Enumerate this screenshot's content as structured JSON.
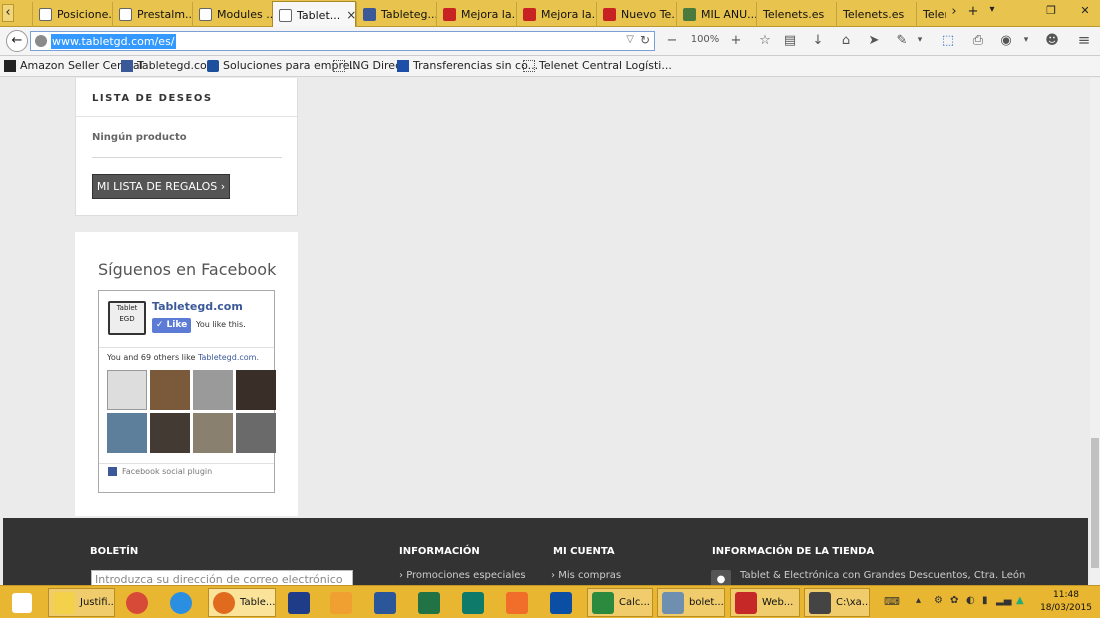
{
  "browser": {
    "tabs": [
      {
        "label": "Posicione...",
        "icon": "page-icon"
      },
      {
        "label": "Prestalm...",
        "icon": "page-icon"
      },
      {
        "label": "Modules ...",
        "icon": "page-icon"
      },
      {
        "label": "Tablet...",
        "icon": "page-icon",
        "active": true,
        "close": "×"
      },
      {
        "label": "Tableteg...",
        "icon": "facebook-icon"
      },
      {
        "label": "Mejora la...",
        "icon": "w-icon"
      },
      {
        "label": "Mejora la...",
        "icon": "w-icon"
      },
      {
        "label": "Nuevo Te...",
        "icon": "w-icon"
      },
      {
        "label": "MIL ANU...",
        "icon": "m-icon"
      },
      {
        "label": "Telenets.es",
        "icon": "none"
      },
      {
        "label": "Telenets.es",
        "icon": "none"
      },
      {
        "label": "Telen",
        "icon": "none"
      }
    ],
    "tab_controls": {
      "scroll_left": "‹",
      "scroll_right": "›",
      "new_tab": "+",
      "list": "▾",
      "restore": "❐",
      "close": "✕"
    },
    "url": "www.tabletgd.com/es/",
    "zoom": "100%",
    "nav": {
      "back": "←",
      "zoom_out": "−",
      "zoom_in": "+",
      "star": "☆",
      "clipboard": "▤",
      "download": "↓",
      "home": "⌂",
      "send": "➤",
      "pin": "✎",
      "menu": "≡"
    },
    "bookmarks": [
      {
        "label": "Amazon Seller Central",
        "icon": "amazon-icon"
      },
      {
        "label": "Tabletegd.com",
        "icon": "facebook-icon"
      },
      {
        "label": "Soluciones para empre...",
        "icon": "paypal-icon"
      },
      {
        "label": "ING Direct",
        "icon": "page-icon"
      },
      {
        "label": "Transferencias sin co...",
        "icon": "bank-icon"
      },
      {
        "label": "Telenet Central Logísti...",
        "icon": "page-icon"
      }
    ]
  },
  "page": {
    "wishlist": {
      "heading": "LISTA DE DESEOS",
      "empty": "Ningún producto",
      "button": "MI LISTA DE REGALOS ›"
    },
    "facebook": {
      "title": "Síguenos en Facebook",
      "page_name": "Tabletegd.com",
      "logo_text": "Tablet EGD",
      "like_button": "Like",
      "you_like": "You like this.",
      "others_prefix": "You and 69 others like ",
      "others_link": "Tabletegd.com.",
      "plugin": "Facebook social plugin",
      "faces": [
        "logo",
        "photo",
        "photo",
        "photo",
        "photo",
        "photo",
        "photo",
        "photo"
      ]
    },
    "footer": {
      "newsletter_heading": "BOLETÍN",
      "newsletter_placeholder": "Introduzca su dirección de correo electrónico",
      "info_heading": "INFORMACIÓN",
      "info_link": "Promociones especiales",
      "account_heading": "MI CUENTA",
      "account_link": "Mis compras",
      "store_heading": "INFORMACIÓN DE LA TIENDA",
      "store_text": "Tablet & Electrónica con Grandes Descuentos, Ctra. León"
    }
  },
  "taskbar": {
    "items": [
      {
        "label": "Justifi...",
        "icon": "folder-icon",
        "color": "#f4d14b"
      },
      {
        "label": "",
        "icon": "chrome-icon",
        "color": "#d84a38"
      },
      {
        "label": "",
        "icon": "ie-icon",
        "color": "#2a8fe0"
      },
      {
        "label": "Table...",
        "icon": "firefox-icon",
        "color": "#e06b1f",
        "active": true
      },
      {
        "label": "",
        "icon": "photoshop-icon",
        "color": "#1f3c88"
      },
      {
        "label": "",
        "icon": "outlook-icon",
        "color": "#f0a030"
      },
      {
        "label": "",
        "icon": "word-icon",
        "color": "#2b579a"
      },
      {
        "label": "",
        "icon": "excel-icon",
        "color": "#217346"
      },
      {
        "label": "",
        "icon": "publisher-icon",
        "color": "#0e7a6a"
      },
      {
        "label": "",
        "icon": "xampp-icon",
        "color": "#f06d2a"
      },
      {
        "label": "",
        "icon": "bbva-icon",
        "color": "#0a4fa3"
      },
      {
        "label": "Calc...",
        "icon": "calc-icon",
        "color": "#2b8a3e"
      },
      {
        "label": "bolet...",
        "icon": "image-icon",
        "color": "#6f8fb0"
      },
      {
        "label": "Web...",
        "icon": "filezilla-icon",
        "color": "#c62828"
      },
      {
        "label": "C:\\xa...",
        "icon": "console-icon",
        "color": "#444444"
      }
    ],
    "clock_time": "11:48",
    "clock_date": "18/03/2015"
  }
}
